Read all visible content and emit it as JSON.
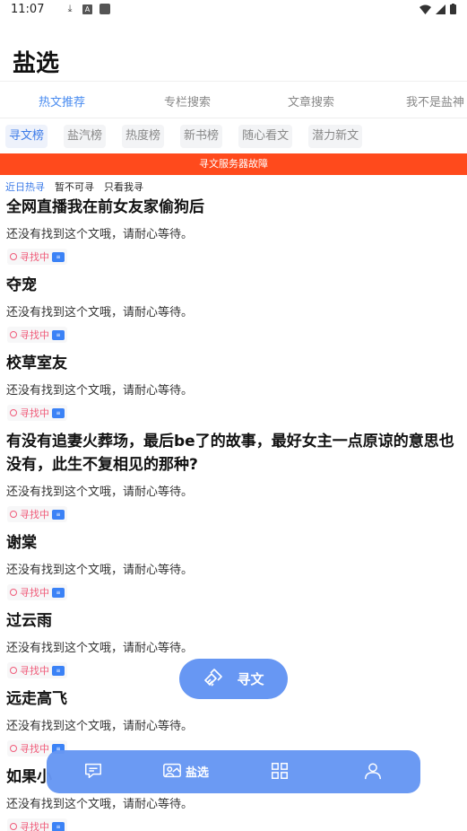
{
  "status_bar": {
    "time": "11:07"
  },
  "header": {
    "title": "盐选"
  },
  "top_tabs": [
    {
      "label": "热文推荐",
      "active": true
    },
    {
      "label": "专栏搜索",
      "active": false
    },
    {
      "label": "文章搜索",
      "active": false
    },
    {
      "label": "我不是盐神",
      "active": false
    }
  ],
  "chips": [
    {
      "label": "寻文榜",
      "active": true
    },
    {
      "label": "盐汽榜",
      "active": false
    },
    {
      "label": "热度榜",
      "active": false
    },
    {
      "label": "新书榜",
      "active": false
    },
    {
      "label": "随心看文",
      "active": false
    },
    {
      "label": "潜力新文",
      "active": false
    }
  ],
  "banner": {
    "text": "寻文服务器故障"
  },
  "filters": [
    {
      "label": "近日热寻",
      "active": true
    },
    {
      "label": "暂不可寻",
      "active": false
    },
    {
      "label": "只看我寻",
      "active": false
    }
  ],
  "items": [
    {
      "title": "全网直播我在前女友家偷狗后",
      "desc": "还没有找到这个文哦，请耐心等待。",
      "tag": "寻找中"
    },
    {
      "title": "夺宠",
      "desc": "还没有找到这个文哦，请耐心等待。",
      "tag": "寻找中"
    },
    {
      "title": "校草室友",
      "desc": "还没有找到这个文哦，请耐心等待。",
      "tag": "寻找中"
    },
    {
      "title": "有没有追妻火葬场，最后be了的故事，最好女主一点原谅的意思也没有，此生不复相见的那种?",
      "desc": "还没有找到这个文哦，请耐心等待。",
      "tag": "寻找中"
    },
    {
      "title": "谢棠",
      "desc": "还没有找到这个文哦，请耐心等待。",
      "tag": "寻找中"
    },
    {
      "title": "过云雨",
      "desc": "还没有找到这个文哦，请耐心等待。",
      "tag": "寻找中"
    },
    {
      "title": "远走高飞",
      "desc": "还没有找到这个文哦，请耐心等待。",
      "tag": "寻找中"
    },
    {
      "title": "如果小",
      "desc": "还没有找到这个文哦，请耐心等待。",
      "tag": "寻找中"
    }
  ],
  "fab": {
    "label": "寻文",
    "icon": "handshake-icon"
  },
  "bottom_nav": [
    {
      "icon": "chat-icon",
      "label": ""
    },
    {
      "icon": "yanxuan-icon",
      "label": "盐选",
      "active": true
    },
    {
      "icon": "grid-icon",
      "label": ""
    },
    {
      "icon": "user-icon",
      "label": ""
    }
  ],
  "colors": {
    "accent": "#4a8cf0",
    "banner": "#ff4a1c",
    "tag": "#f05c7a",
    "nav": "#6797f3"
  }
}
